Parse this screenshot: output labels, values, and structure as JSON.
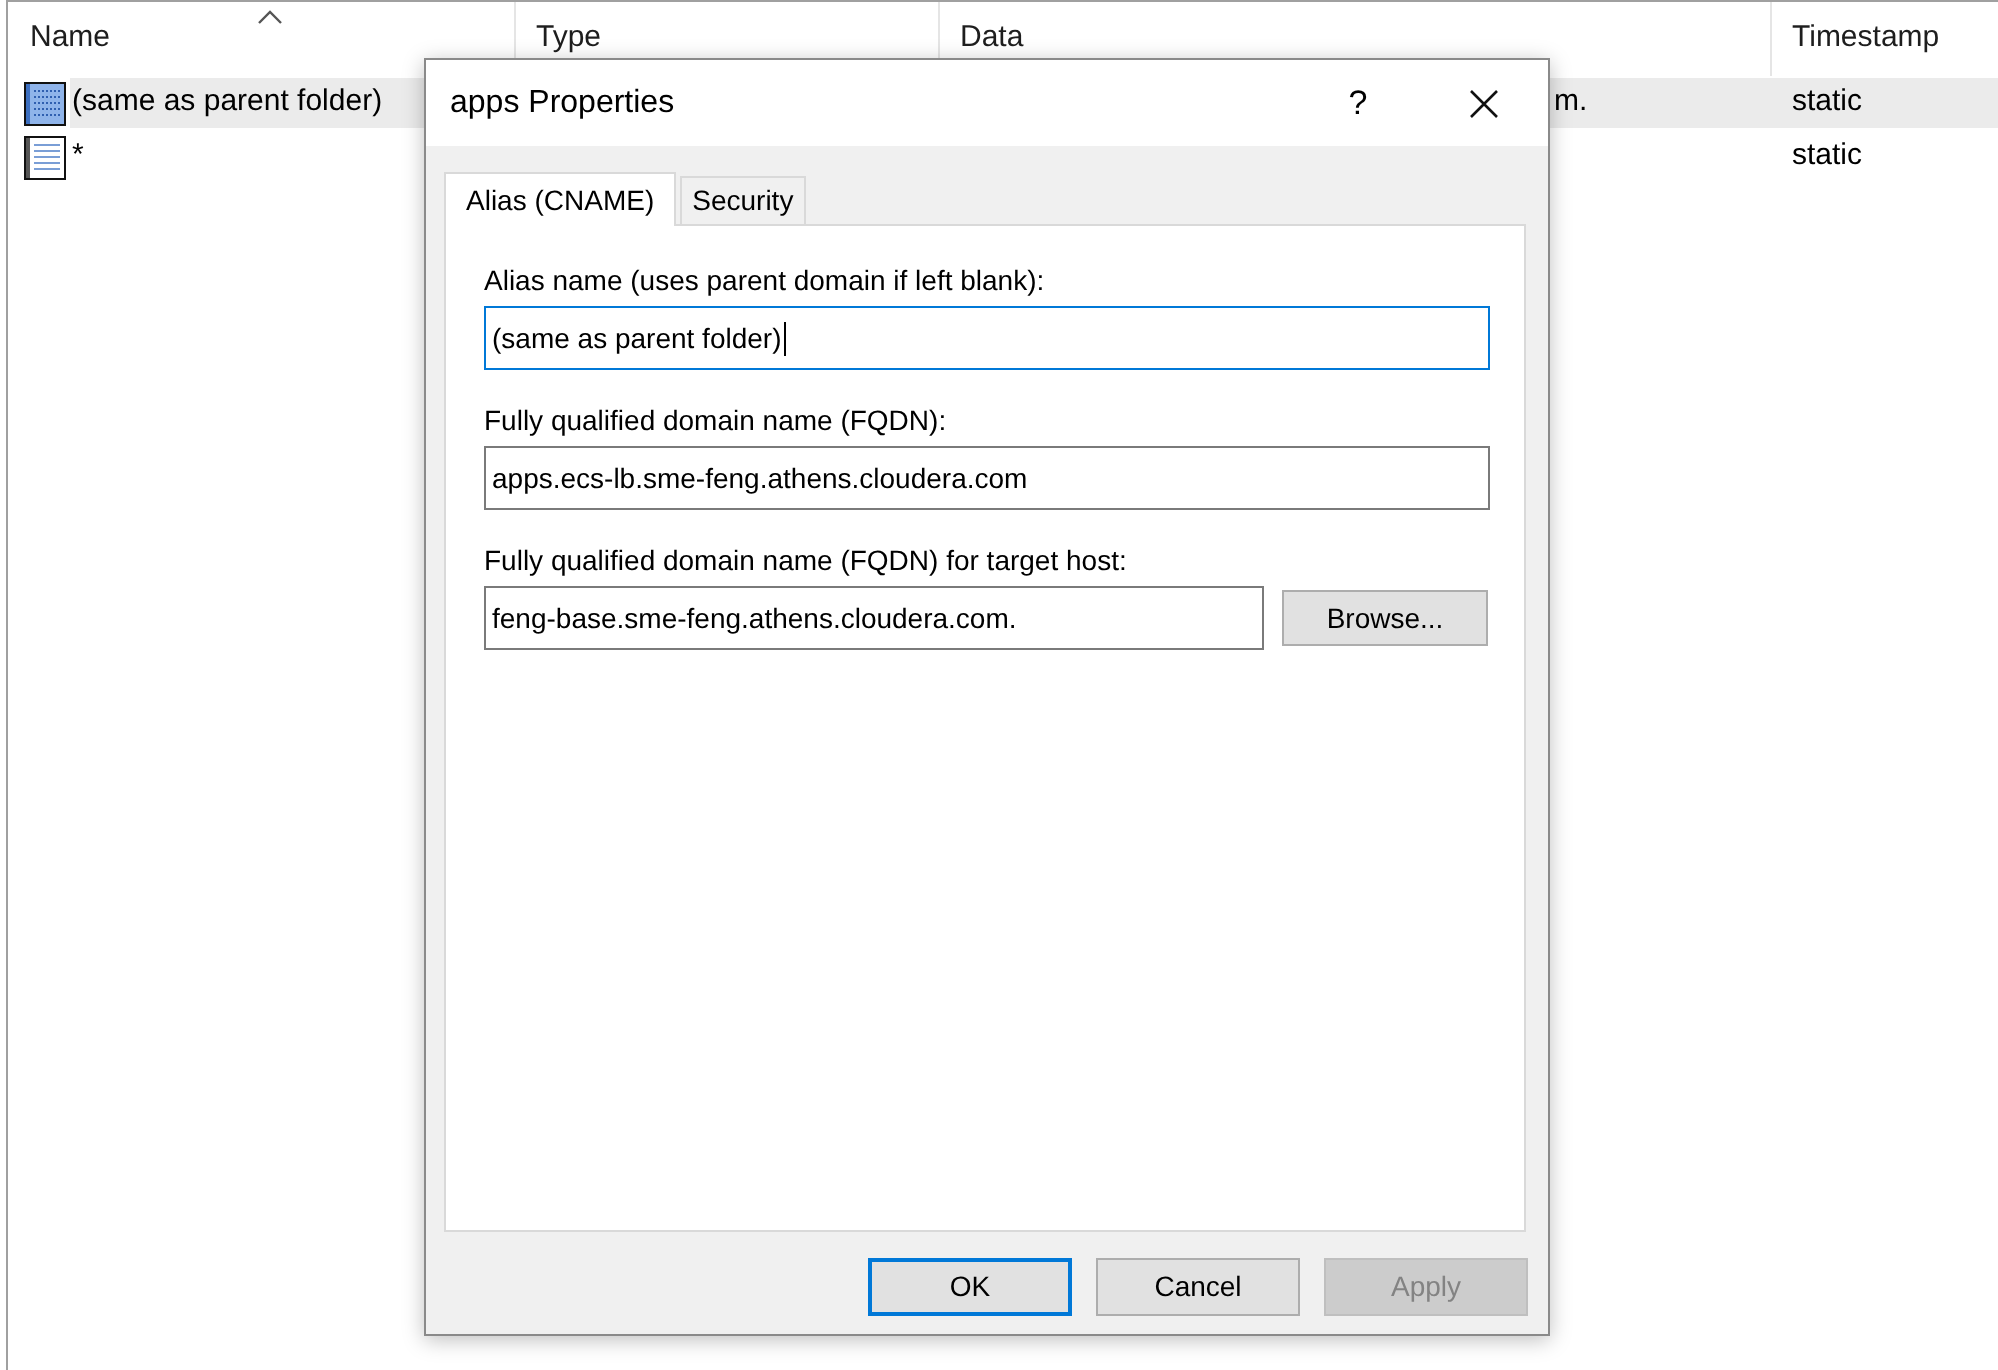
{
  "list": {
    "columns": [
      {
        "label": "Name",
        "sorted": true
      },
      {
        "label": "Type",
        "sorted": false
      },
      {
        "label": "Data",
        "sorted": false
      },
      {
        "label": "Timestamp",
        "sorted": false
      }
    ],
    "rows": [
      {
        "name": "(same as parent folder)",
        "data": "m.",
        "timestamp": "static",
        "selected": true
      },
      {
        "name": "*",
        "timestamp": "static",
        "selected": false
      }
    ]
  },
  "dialog": {
    "title": "apps Properties",
    "help": "?",
    "tabs": [
      {
        "label": "Alias (CNAME)",
        "selected": true
      },
      {
        "label": "Security",
        "selected": false
      }
    ],
    "fields": [
      {
        "label": "Alias name (uses parent domain if left blank):",
        "value": "(same as parent folder)",
        "focused": true
      },
      {
        "label": "Fully qualified domain name (FQDN):",
        "value": "apps.ecs-lb.sme-feng.athens.cloudera.com",
        "focused": false
      },
      {
        "label": "Fully qualified domain name (FQDN) for target host:",
        "value": "feng-base.sme-feng.athens.cloudera.com.",
        "focused": false,
        "button": "Browse..."
      }
    ],
    "buttons": [
      {
        "label": "OK",
        "default": true,
        "disabled": false
      },
      {
        "label": "Cancel",
        "default": false,
        "disabled": false
      },
      {
        "label": "Apply",
        "default": false,
        "disabled": true
      }
    ]
  }
}
